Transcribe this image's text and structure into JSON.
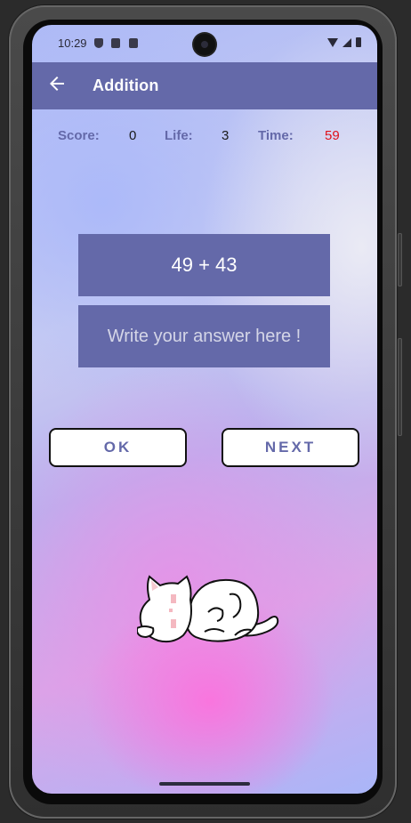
{
  "status_bar": {
    "time": "10:29",
    "left_icons": [
      "shield-icon",
      "sd-card-icon",
      "font-a-icon"
    ],
    "right_icons": [
      "wifi-icon",
      "signal-icon",
      "battery-icon"
    ]
  },
  "app_bar": {
    "title": "Addition",
    "back_icon": "arrow-left-icon",
    "color": "#6469a9"
  },
  "stats": {
    "score_label": "Score:",
    "score_value": "0",
    "life_label": "Life:",
    "life_value": "3",
    "time_label": "Time:",
    "time_value": "59",
    "time_color": "#e0101a"
  },
  "question": {
    "text": "49 + 43"
  },
  "answer": {
    "value": "",
    "placeholder": "Write your answer here !"
  },
  "buttons": {
    "ok_label": "OK",
    "next_label": "NEXT"
  },
  "illustration": {
    "icon": "sleeping-cat-icon"
  },
  "colors": {
    "accent": "#6469a9",
    "button_border": "#111111"
  }
}
